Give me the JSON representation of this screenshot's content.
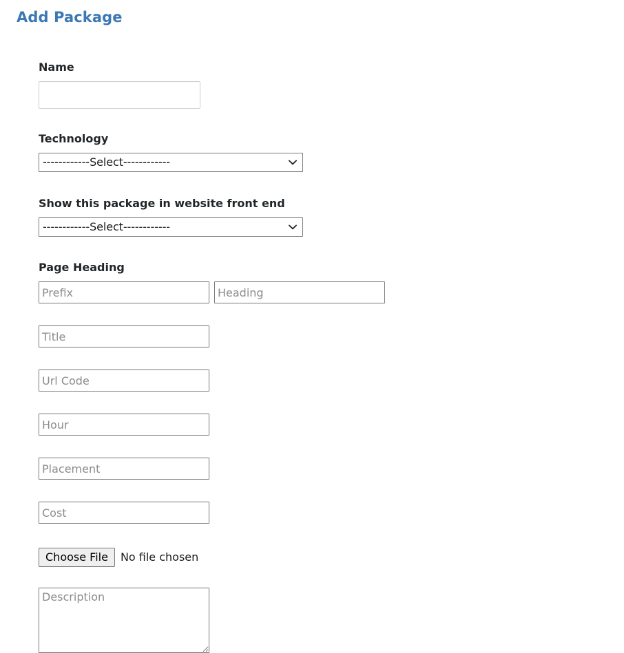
{
  "page": {
    "title": "Add Package",
    "title_color": "#3c78b4"
  },
  "form": {
    "name": {
      "label": "Name",
      "value": "",
      "placeholder": ""
    },
    "technology": {
      "label": "Technology",
      "selected": "------------Select------------",
      "options": [
        "------------Select------------"
      ]
    },
    "show_front_end": {
      "label": "Show this package in website front end",
      "selected": "------------Select------------",
      "options": [
        "------------Select------------"
      ]
    },
    "page_heading": {
      "label": "Page Heading",
      "prefix": {
        "placeholder": "Prefix",
        "value": ""
      },
      "heading": {
        "placeholder": "Heading",
        "value": ""
      }
    },
    "title_field": {
      "placeholder": "Title",
      "value": ""
    },
    "url_code": {
      "placeholder": "Url Code",
      "value": ""
    },
    "hour": {
      "placeholder": "Hour",
      "value": ""
    },
    "placement": {
      "placeholder": "Placement",
      "value": ""
    },
    "cost": {
      "placeholder": "Cost",
      "value": ""
    },
    "file_upload": {
      "button_label": "Choose File",
      "status": "No file chosen"
    },
    "description": {
      "placeholder": "Description",
      "value": ""
    }
  },
  "icons": {
    "chevron_down": "chevron-down-icon"
  }
}
